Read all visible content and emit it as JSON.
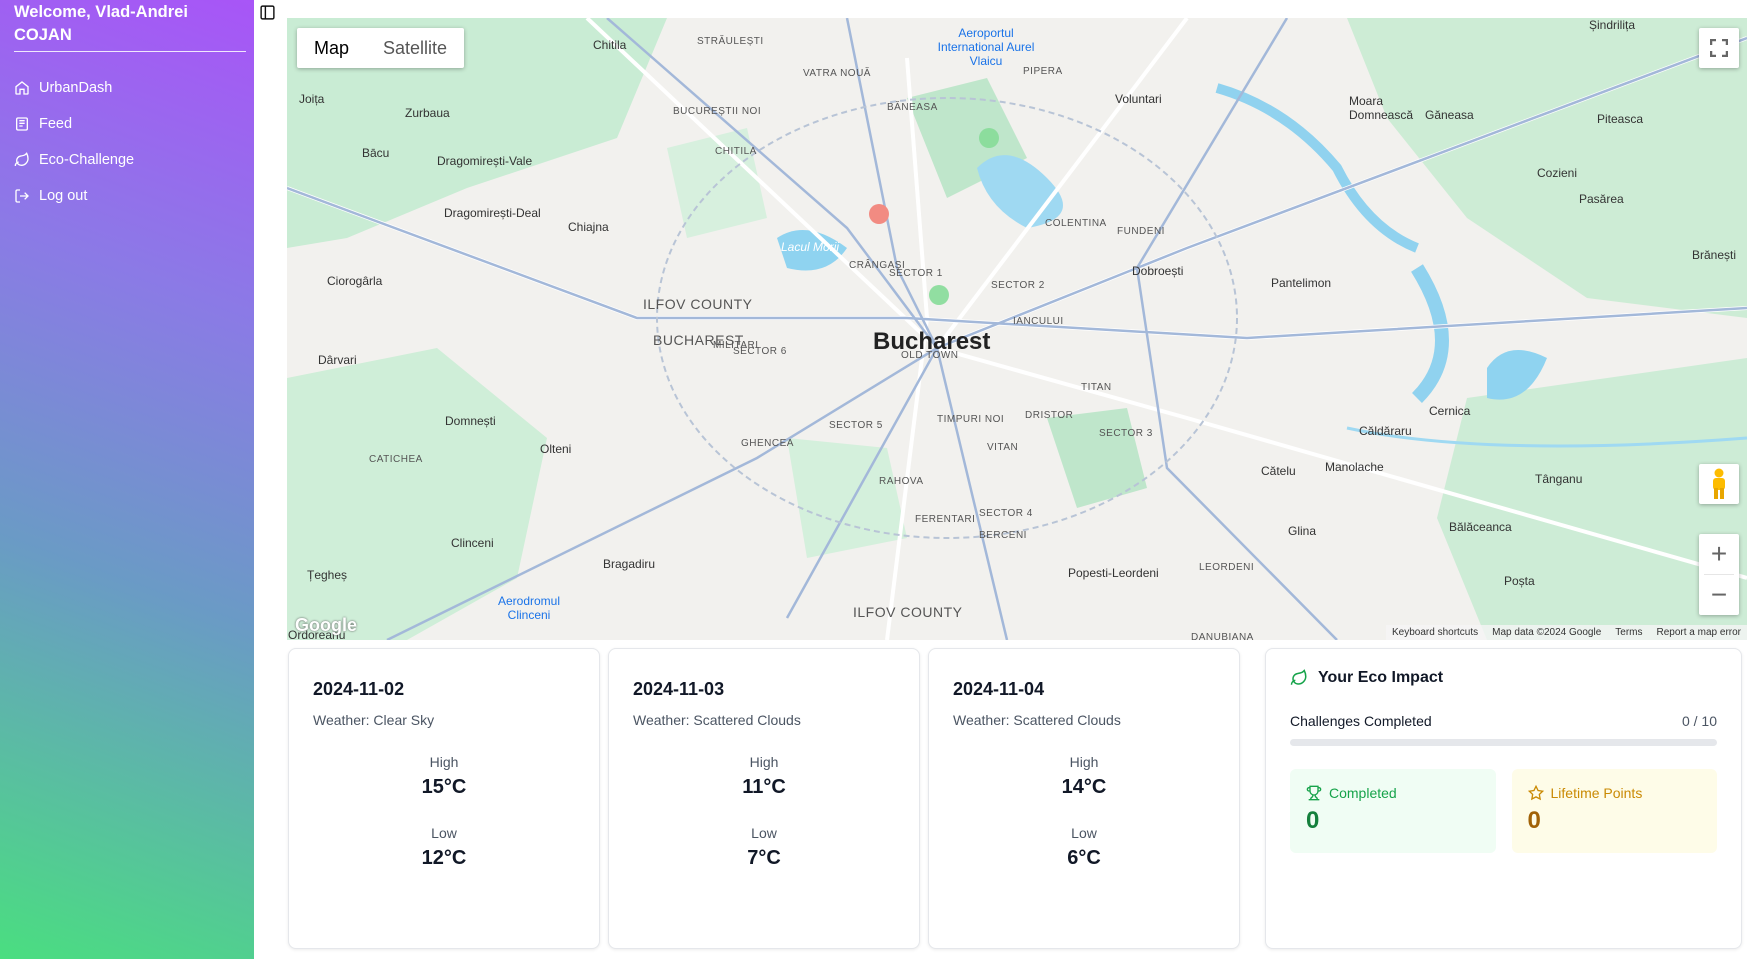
{
  "sidebar": {
    "welcome": "Welcome, Vlad-Andrei COJAN",
    "items": [
      {
        "label": "UrbanDash",
        "icon": "home-icon"
      },
      {
        "label": "Feed",
        "icon": "newspaper-icon"
      },
      {
        "label": "Eco-Challenge",
        "icon": "leaf-icon"
      },
      {
        "label": "Log out",
        "icon": "logout-icon"
      }
    ]
  },
  "map": {
    "type_buttons": {
      "map": "Map",
      "satellite": "Satellite"
    },
    "footer": {
      "shortcuts": "Keyboard shortcuts",
      "data": "Map data ©2024 Google",
      "terms": "Terms",
      "report": "Report a map error"
    },
    "logo": "Google",
    "labels": {
      "bucharest": "Bucharest",
      "chitila": "Chitila",
      "voluntari": "Voluntari",
      "chiajna": "Chiajna",
      "zurbaua": "Zurbaua",
      "bacu": "Bācu",
      "dragomiresti_vale": "Dragomirești-Vale",
      "dragomiresti_deal": "Dragomirești-Deal",
      "ciorogarla": "Ciorogârla",
      "darvari": "Dârvari",
      "domnesti": "Domnești",
      "olteni": "Olteni",
      "clinceni": "Clinceni",
      "bragadiru": "Bragadiru",
      "teghes": "Țegheș",
      "ordoreanu": "Ordoreanu",
      "dobroesti": "Dobroești",
      "pantelimon": "Pantelimon",
      "caldararu": "Căldăraru",
      "cernica": "Cernica",
      "catelu": "Cătelu",
      "manolache": "Manolache",
      "glina": "Glina",
      "popesti": "Popesti-Leordeni",
      "balaceanca": "Bălăceanca",
      "tanganu": "Tânganu",
      "posta": "Poșta",
      "ganeasa": "Găneasa",
      "moara": "Moara Domnească",
      "pasarea": "Pasărea",
      "cozieni": "Cozieni",
      "piteasca": "Piteasca",
      "sindrilita": "Șindrilița",
      "branesti": "Brănești",
      "joita": "Joița",
      "airport": "Aeroportul International Aurel Vlaicu",
      "airport2": "Aerodromul Clinceni",
      "lake": "Lacul Morii",
      "ilfov1": "ILFOV COUNTY",
      "ilfov2": "ILFOV COUNTY",
      "bucharest_county": "BUCHAREST",
      "old_town": "OLD TOWN",
      "sector1": "SECTOR 1",
      "sector2": "SECTOR 2",
      "sector3": "SECTOR 3",
      "sector4": "SECTOR 4",
      "sector5": "SECTOR 5",
      "sector6": "SECTOR 6",
      "titan": "TITAN",
      "vitan": "VITAN",
      "rahova": "RAHOVA",
      "ferentari": "FERENTARI",
      "berceni": "BERCENI",
      "militari": "MILITARI",
      "crangasi": "CRÂNGAȘI",
      "colentina": "COLENTINA",
      "pipera": "PIPERA",
      "baneasa": "BĂNEASA",
      "fundeni": "FUNDENI",
      "iancului": "IANCULUI",
      "dristor": "DRISTOR",
      "ghencea": "GHENCEA",
      "timpuri_noi": "TIMPURI NOI",
      "straulesti": "STRĂULEȘTI",
      "vatra_noua": "VATRA NOUĂ",
      "bucurestii_noi": "BUCUREȘTII NOI",
      "chitila_n": "CHITILA",
      "catichea": "CATICHEA",
      "leordeni": "LEORDENI",
      "danubiana": "DANUBIANA"
    }
  },
  "weather": [
    {
      "date": "2024-11-02",
      "condition": "Weather: Clear Sky",
      "high_label": "High",
      "high": "15°C",
      "low_label": "Low",
      "low": "12°C"
    },
    {
      "date": "2024-11-03",
      "condition": "Weather: Scattered Clouds",
      "high_label": "High",
      "high": "11°C",
      "low_label": "Low",
      "low": "7°C"
    },
    {
      "date": "2024-11-04",
      "condition": "Weather: Scattered Clouds",
      "high_label": "High",
      "high": "14°C",
      "low_label": "Low",
      "low": "6°C"
    }
  ],
  "eco": {
    "title": "Your Eco Impact",
    "challenges_label": "Challenges Completed",
    "challenges_count": "0 / 10",
    "progress_fraction": 0,
    "completed_label": "Completed",
    "completed_value": "0",
    "points_label": "Lifetime Points",
    "points_value": "0"
  }
}
